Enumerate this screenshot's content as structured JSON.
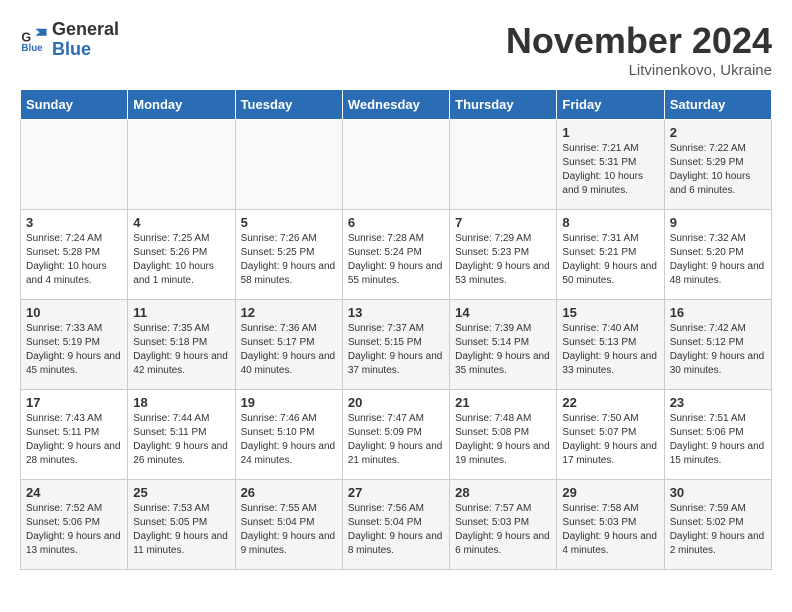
{
  "logo": {
    "line1": "General",
    "line2": "Blue"
  },
  "title": "November 2024",
  "location": "Litvinenkovo, Ukraine",
  "days_of_week": [
    "Sunday",
    "Monday",
    "Tuesday",
    "Wednesday",
    "Thursday",
    "Friday",
    "Saturday"
  ],
  "weeks": [
    [
      {
        "day": "",
        "info": ""
      },
      {
        "day": "",
        "info": ""
      },
      {
        "day": "",
        "info": ""
      },
      {
        "day": "",
        "info": ""
      },
      {
        "day": "",
        "info": ""
      },
      {
        "day": "1",
        "info": "Sunrise: 7:21 AM\nSunset: 5:31 PM\nDaylight: 10 hours and 9 minutes."
      },
      {
        "day": "2",
        "info": "Sunrise: 7:22 AM\nSunset: 5:29 PM\nDaylight: 10 hours and 6 minutes."
      }
    ],
    [
      {
        "day": "3",
        "info": "Sunrise: 7:24 AM\nSunset: 5:28 PM\nDaylight: 10 hours and 4 minutes."
      },
      {
        "day": "4",
        "info": "Sunrise: 7:25 AM\nSunset: 5:26 PM\nDaylight: 10 hours and 1 minute."
      },
      {
        "day": "5",
        "info": "Sunrise: 7:26 AM\nSunset: 5:25 PM\nDaylight: 9 hours and 58 minutes."
      },
      {
        "day": "6",
        "info": "Sunrise: 7:28 AM\nSunset: 5:24 PM\nDaylight: 9 hours and 55 minutes."
      },
      {
        "day": "7",
        "info": "Sunrise: 7:29 AM\nSunset: 5:23 PM\nDaylight: 9 hours and 53 minutes."
      },
      {
        "day": "8",
        "info": "Sunrise: 7:31 AM\nSunset: 5:21 PM\nDaylight: 9 hours and 50 minutes."
      },
      {
        "day": "9",
        "info": "Sunrise: 7:32 AM\nSunset: 5:20 PM\nDaylight: 9 hours and 48 minutes."
      }
    ],
    [
      {
        "day": "10",
        "info": "Sunrise: 7:33 AM\nSunset: 5:19 PM\nDaylight: 9 hours and 45 minutes."
      },
      {
        "day": "11",
        "info": "Sunrise: 7:35 AM\nSunset: 5:18 PM\nDaylight: 9 hours and 42 minutes."
      },
      {
        "day": "12",
        "info": "Sunrise: 7:36 AM\nSunset: 5:17 PM\nDaylight: 9 hours and 40 minutes."
      },
      {
        "day": "13",
        "info": "Sunrise: 7:37 AM\nSunset: 5:15 PM\nDaylight: 9 hours and 37 minutes."
      },
      {
        "day": "14",
        "info": "Sunrise: 7:39 AM\nSunset: 5:14 PM\nDaylight: 9 hours and 35 minutes."
      },
      {
        "day": "15",
        "info": "Sunrise: 7:40 AM\nSunset: 5:13 PM\nDaylight: 9 hours and 33 minutes."
      },
      {
        "day": "16",
        "info": "Sunrise: 7:42 AM\nSunset: 5:12 PM\nDaylight: 9 hours and 30 minutes."
      }
    ],
    [
      {
        "day": "17",
        "info": "Sunrise: 7:43 AM\nSunset: 5:11 PM\nDaylight: 9 hours and 28 minutes."
      },
      {
        "day": "18",
        "info": "Sunrise: 7:44 AM\nSunset: 5:11 PM\nDaylight: 9 hours and 26 minutes."
      },
      {
        "day": "19",
        "info": "Sunrise: 7:46 AM\nSunset: 5:10 PM\nDaylight: 9 hours and 24 minutes."
      },
      {
        "day": "20",
        "info": "Sunrise: 7:47 AM\nSunset: 5:09 PM\nDaylight: 9 hours and 21 minutes."
      },
      {
        "day": "21",
        "info": "Sunrise: 7:48 AM\nSunset: 5:08 PM\nDaylight: 9 hours and 19 minutes."
      },
      {
        "day": "22",
        "info": "Sunrise: 7:50 AM\nSunset: 5:07 PM\nDaylight: 9 hours and 17 minutes."
      },
      {
        "day": "23",
        "info": "Sunrise: 7:51 AM\nSunset: 5:06 PM\nDaylight: 9 hours and 15 minutes."
      }
    ],
    [
      {
        "day": "24",
        "info": "Sunrise: 7:52 AM\nSunset: 5:06 PM\nDaylight: 9 hours and 13 minutes."
      },
      {
        "day": "25",
        "info": "Sunrise: 7:53 AM\nSunset: 5:05 PM\nDaylight: 9 hours and 11 minutes."
      },
      {
        "day": "26",
        "info": "Sunrise: 7:55 AM\nSunset: 5:04 PM\nDaylight: 9 hours and 9 minutes."
      },
      {
        "day": "27",
        "info": "Sunrise: 7:56 AM\nSunset: 5:04 PM\nDaylight: 9 hours and 8 minutes."
      },
      {
        "day": "28",
        "info": "Sunrise: 7:57 AM\nSunset: 5:03 PM\nDaylight: 9 hours and 6 minutes."
      },
      {
        "day": "29",
        "info": "Sunrise: 7:58 AM\nSunset: 5:03 PM\nDaylight: 9 hours and 4 minutes."
      },
      {
        "day": "30",
        "info": "Sunrise: 7:59 AM\nSunset: 5:02 PM\nDaylight: 9 hours and 2 minutes."
      }
    ]
  ]
}
